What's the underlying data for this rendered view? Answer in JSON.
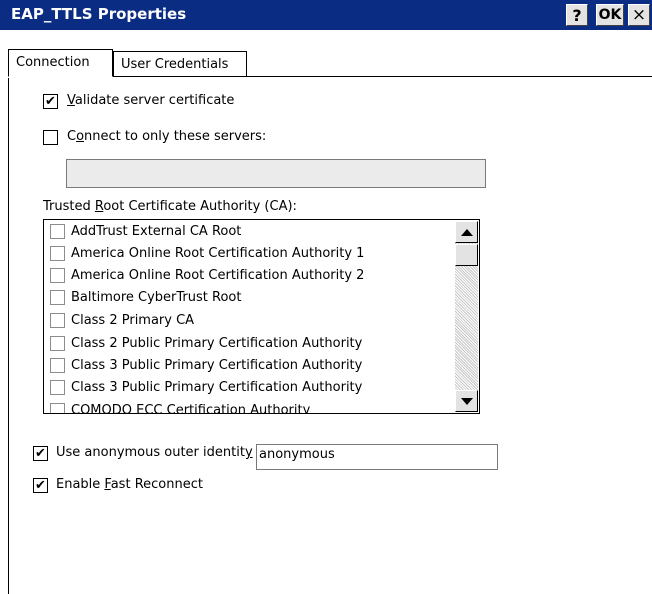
{
  "window": {
    "title": "EAP_TTLS Properties",
    "help_label": "?",
    "ok_label": "OK",
    "close_label": "×"
  },
  "tabs": [
    {
      "label": "Connection",
      "selected": true
    },
    {
      "label": "User Credentials",
      "selected": false
    }
  ],
  "connection": {
    "validate_cert": {
      "checked": true,
      "accel": "V",
      "rest": "alidate server certificate"
    },
    "connect_only": {
      "checked": false,
      "pre": "C",
      "accel": "o",
      "rest": "nnect to only these servers:"
    },
    "servers_value": "",
    "trusted_root": {
      "pre": "Trusted ",
      "accel": "R",
      "rest": "oot Certificate Authority (CA):"
    },
    "ca_list": [
      {
        "label": "AddTrust External CA Root",
        "checked": false
      },
      {
        "label": "America Online Root Certification Authority 1",
        "checked": false
      },
      {
        "label": "America Online Root Certification Authority 2",
        "checked": false
      },
      {
        "label": "Baltimore CyberTrust Root",
        "checked": false
      },
      {
        "label": "Class 2 Primary CA",
        "checked": false
      },
      {
        "label": "Class 2 Public Primary Certification Authority",
        "checked": false
      },
      {
        "label": "Class 3 Public Primary Certification Authority",
        "checked": false
      },
      {
        "label": "Class 3 Public Primary Certification Authority",
        "checked": false
      },
      {
        "label": "COMODO ECC Certification Authority",
        "checked": false
      }
    ],
    "anonymous": {
      "checked": true,
      "pre": "Use anonymous outer identit",
      "accel": "y",
      "value": "anonymous"
    },
    "fast_reconnect": {
      "checked": true,
      "pre": "Enable ",
      "accel": "F",
      "rest": "ast Reconnect"
    }
  },
  "colors": {
    "titlebar": "#0b2c83",
    "field_disabled": "#ebebeb"
  },
  "icons": {
    "help": "question-mark",
    "ok": "ok-text",
    "close": "x-mark",
    "scroll_up": "triangle-up",
    "scroll_down": "triangle-down",
    "check": "check-mark"
  }
}
